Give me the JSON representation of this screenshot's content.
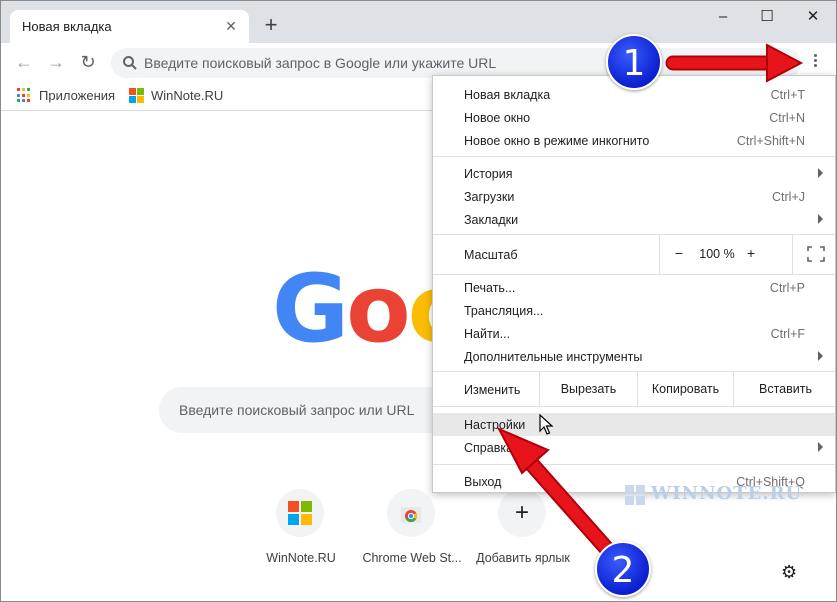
{
  "browser": {
    "tab": {
      "title": "Новая вкладка",
      "close_icon": "close-icon"
    },
    "new_tab_label": "+",
    "window_controls": {
      "minimize": "–",
      "maximize": "☐",
      "close": "✕"
    },
    "omnibox_placeholder": "Введите поисковый запрос в Google или укажите URL",
    "bookmarks": [
      {
        "label": "Приложения",
        "icon": "apps-grid-icon"
      },
      {
        "label": "WinNote.RU",
        "icon": "winnote-logo-icon"
      }
    ]
  },
  "page": {
    "logo_letters": [
      "G",
      "o",
      "o"
    ],
    "logo_colors": [
      "#4285f4",
      "#ea4335",
      "#fbbc05"
    ],
    "search_placeholder": "Введите поисковый запрос или URL",
    "shortcuts": [
      {
        "label": "WinNote.RU",
        "icon": "winnote-logo-icon"
      },
      {
        "label": "Chrome Web St...",
        "icon": "chrome-web-store-icon"
      },
      {
        "label": "Добавить ярлык",
        "icon": "plus-icon",
        "glyph": "+"
      }
    ]
  },
  "menu": {
    "group1": [
      {
        "label": "Новая вкладка",
        "shortcut": "Ctrl+T"
      },
      {
        "label": "Новое окно",
        "shortcut": "Ctrl+N"
      },
      {
        "label": "Новое окно в режиме инкогнито",
        "shortcut": "Ctrl+Shift+N"
      }
    ],
    "group2": [
      {
        "label": "История",
        "shortcut": ""
      },
      {
        "label": "Загрузки",
        "shortcut": "Ctrl+J"
      },
      {
        "label": "Закладки",
        "shortcut": ""
      }
    ],
    "zoom": {
      "label": "Масштаб",
      "minus": "−",
      "value": "100 %",
      "plus": "+"
    },
    "group3": [
      {
        "label": "Печать...",
        "shortcut": "Ctrl+P"
      },
      {
        "label": "Трансляция...",
        "shortcut": ""
      },
      {
        "label": "Найти...",
        "shortcut": "Ctrl+F"
      },
      {
        "label": "Дополнительные инструменты",
        "shortcut": ""
      }
    ],
    "edit": {
      "label": "Изменить",
      "cut": "Вырезать",
      "copy": "Копировать",
      "paste": "Вставить"
    },
    "group4": [
      {
        "label": "Настройки",
        "shortcut": ""
      },
      {
        "label": "Справка",
        "shortcut": ""
      }
    ],
    "exit": {
      "label": "Выход",
      "shortcut": "Ctrl+Shift+Q"
    }
  },
  "annotations": {
    "marker1": "1",
    "marker2": "2",
    "arrow_color": "#e8141b",
    "marker_color": "#0b1fcf",
    "watermark": "WINNOTE.RU"
  }
}
